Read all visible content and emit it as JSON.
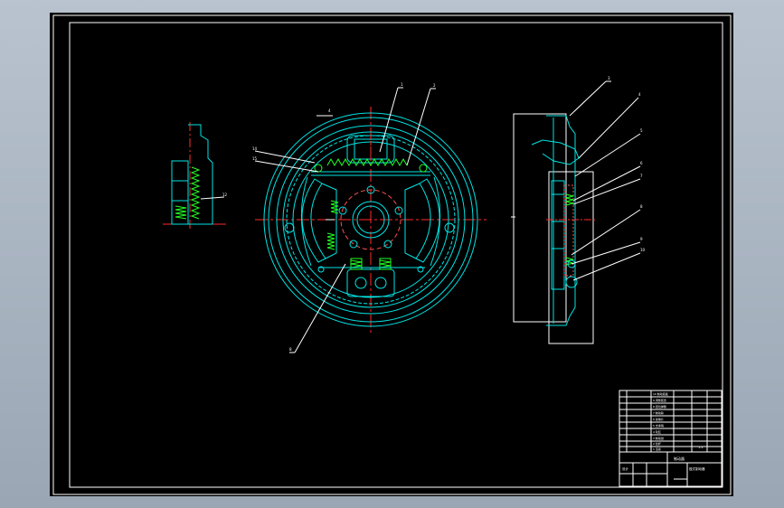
{
  "drawing": {
    "callouts_main": [
      "1",
      "2",
      "14",
      "15",
      "8"
    ],
    "callouts_right": [
      "3",
      "4",
      "5",
      "6",
      "7",
      "8",
      "9",
      "10"
    ],
    "callout_left": "12",
    "dimension_label": "4",
    "title_block": {
      "part_label": "制动器",
      "scale_label": "1:1",
      "drawing_no": "鼓式制动器",
      "designer_label": "设计",
      "rows": [
        "10 制动底板",
        "9 调整装置",
        "8 回位弹簧",
        "7 制动蹄",
        "6 摩擦片",
        "5 支承销",
        "4 轮缸",
        "3 制动鼓",
        "2 拉杆",
        "1 活塞"
      ]
    }
  },
  "colors": {
    "background": "#000000",
    "frame": "#ffffff",
    "outline": "#00e5e5",
    "centerline": "#ff2a2a",
    "spring": "#22ff22",
    "hatch": "#ff5050",
    "text": "#ffffff"
  }
}
